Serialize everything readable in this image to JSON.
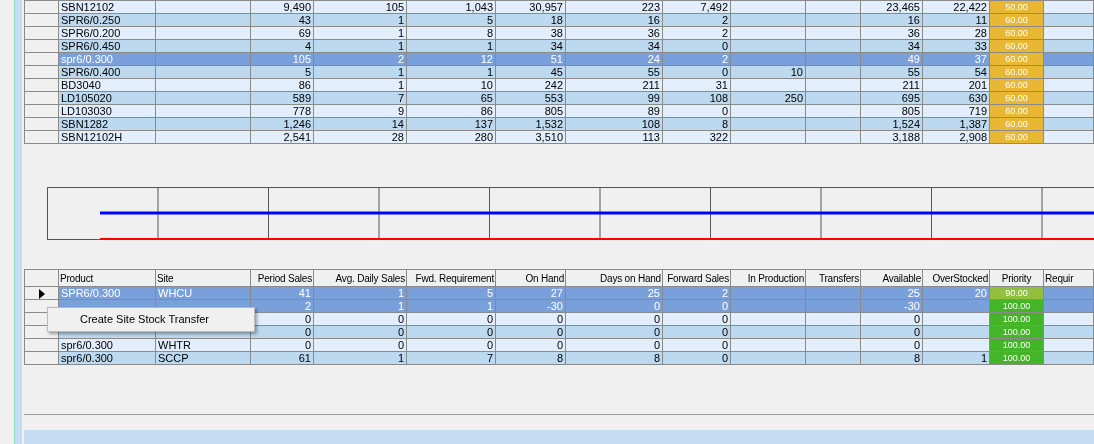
{
  "top_table": {
    "rows": [
      {
        "product": "SBN12102",
        "cells": [
          "9,490",
          "105",
          "1,043",
          "30,957",
          "223",
          "7,492",
          "",
          "",
          "23,465",
          "22,422"
        ],
        "priority": "50.00",
        "color": "#e8b834",
        "selected": false
      },
      {
        "product": "SPR6/0.250",
        "cells": [
          "43",
          "1",
          "5",
          "18",
          "16",
          "2",
          "",
          "",
          "16",
          "11"
        ],
        "priority": "60.00",
        "color": "#e8b834",
        "selected": false
      },
      {
        "product": "SPR6/0.200",
        "cells": [
          "69",
          "1",
          "8",
          "38",
          "36",
          "2",
          "",
          "",
          "36",
          "28"
        ],
        "priority": "60.00",
        "color": "#e8b834",
        "selected": false
      },
      {
        "product": "SPR6/0.450",
        "cells": [
          "4",
          "1",
          "1",
          "34",
          "34",
          "0",
          "",
          "",
          "34",
          "33"
        ],
        "priority": "60.00",
        "color": "#e8b834",
        "selected": false
      },
      {
        "product": "spr6/0.300",
        "cells": [
          "105",
          "2",
          "12",
          "51",
          "24",
          "2",
          "",
          "",
          "49",
          "37"
        ],
        "priority": "60.00",
        "color": "#e8b834",
        "selected": true
      },
      {
        "product": "SPR6/0.400",
        "cells": [
          "5",
          "1",
          "1",
          "45",
          "55",
          "0",
          "10",
          "",
          "55",
          "54"
        ],
        "priority": "60.00",
        "color": "#e8b834",
        "selected": false
      },
      {
        "product": "BD3040",
        "cells": [
          "86",
          "1",
          "10",
          "242",
          "211",
          "31",
          "",
          "",
          "211",
          "201"
        ],
        "priority": "60.00",
        "color": "#e8b834",
        "selected": false
      },
      {
        "product": "LD105020",
        "cells": [
          "589",
          "7",
          "65",
          "553",
          "99",
          "108",
          "250",
          "",
          "695",
          "630"
        ],
        "priority": "60.00",
        "color": "#e8b834",
        "selected": false
      },
      {
        "product": "LD103030",
        "cells": [
          "778",
          "9",
          "86",
          "805",
          "89",
          "0",
          "",
          "",
          "805",
          "719"
        ],
        "priority": "60.00",
        "color": "#e8b834",
        "selected": false
      },
      {
        "product": "SBN1282",
        "cells": [
          "1,246",
          "14",
          "137",
          "1,532",
          "108",
          "8",
          "",
          "",
          "1,524",
          "1,387"
        ],
        "priority": "60.00",
        "color": "#e8b834",
        "selected": false
      },
      {
        "product": "SBN12102H",
        "cells": [
          "2,541",
          "28",
          "280",
          "3,510",
          "113",
          "322",
          "",
          "",
          "3,188",
          "2,908"
        ],
        "priority": "60.00",
        "color": "#e8b834",
        "selected": false
      }
    ]
  },
  "bottom_table": {
    "columns": [
      "Product",
      "Site",
      "Period Sales",
      "Avg. Daily Sales",
      "Fwd. Requirement",
      "On Hand",
      "Days on Hand",
      "Forward Sales",
      "In Production",
      "Transfers",
      "Available",
      "OverStocked",
      "Priority",
      "Requir"
    ],
    "rows": [
      {
        "current": true,
        "cells": [
          "SPR6/0.300",
          "WHCU",
          "41",
          "1",
          "5",
          "27",
          "25",
          "2",
          "",
          "",
          "25",
          "20",
          "90.00"
        ],
        "color": "#93bf3e",
        "selected": true
      },
      {
        "current": false,
        "cells": [
          "",
          "",
          "2",
          "1",
          "1",
          "-30",
          "0",
          "0",
          "",
          "",
          "-30",
          "",
          "100.00"
        ],
        "color": "#44b428",
        "selected": true
      },
      {
        "current": false,
        "cells": [
          "",
          "",
          "0",
          "0",
          "0",
          "0",
          "0",
          "0",
          "",
          "",
          "0",
          "",
          "100.00"
        ],
        "color": "#44b428",
        "selected": false
      },
      {
        "current": false,
        "cells": [
          "",
          "",
          "0",
          "0",
          "0",
          "0",
          "0",
          "0",
          "",
          "",
          "0",
          "",
          "100.00"
        ],
        "color": "#44b428",
        "selected": false
      },
      {
        "current": false,
        "cells": [
          "spr6/0.300",
          "WHTR",
          "0",
          "0",
          "0",
          "0",
          "0",
          "0",
          "",
          "",
          "0",
          "",
          "100.00"
        ],
        "color": "#44b428",
        "selected": false
      },
      {
        "current": false,
        "cells": [
          "spr6/0.300",
          "SCCP",
          "61",
          "1",
          "7",
          "8",
          "8",
          "0",
          "",
          "",
          "8",
          "1",
          "100.00"
        ],
        "color": "#44b428",
        "selected": false
      }
    ]
  },
  "context_menu": {
    "items": [
      "Create Site Stock Transfer"
    ]
  }
}
